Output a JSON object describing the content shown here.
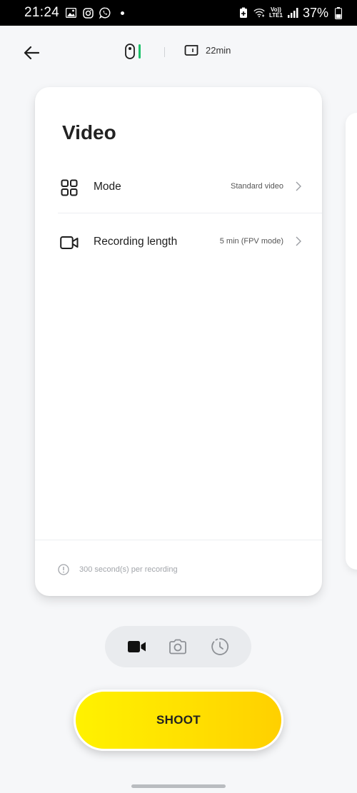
{
  "status_bar": {
    "time": "21:24",
    "battery_percent": "37%",
    "volte_label": "Vo))",
    "lte_label": "LTE1",
    "left_icons": [
      "gallery-icon",
      "instagram-icon",
      "whatsapp-icon",
      "notification-dot"
    ],
    "right_icons": [
      "battery-saver-icon",
      "wifi-icon",
      "signal-icon",
      "battery-icon"
    ]
  },
  "top_bar": {
    "device_icon": "camera-device-icon",
    "device_status_color": "#1ec26b",
    "storage_icon": "sd-card-icon",
    "storage_remaining": "22min"
  },
  "card": {
    "title": "Video",
    "rows": [
      {
        "icon": "grid-icon",
        "label": "Mode",
        "value": "Standard video"
      },
      {
        "icon": "video-camera-icon",
        "label": "Recording length",
        "value": "5 min (FPV mode)"
      }
    ],
    "footer_note": "300 second(s) per recording"
  },
  "mode_switcher": {
    "items": [
      {
        "icon": "video-icon",
        "selected": true
      },
      {
        "icon": "camera-icon",
        "selected": false
      },
      {
        "icon": "timelapse-icon",
        "selected": false
      }
    ]
  },
  "shoot_button": {
    "label": "SHOOT"
  },
  "colors": {
    "accent_yellow": "#ffe000",
    "background": "#f6f7f9",
    "status_green": "#1ec26b"
  }
}
